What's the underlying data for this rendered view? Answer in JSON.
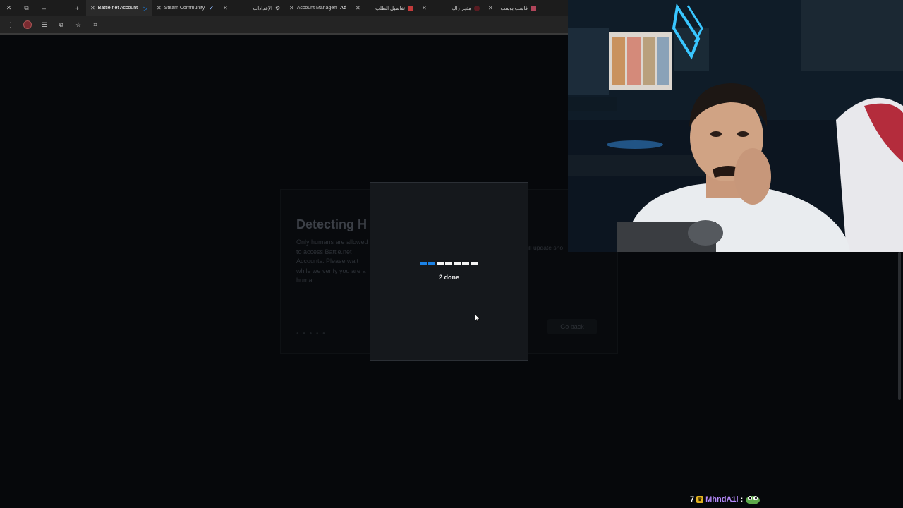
{
  "browser": {
    "tabs": [
      {
        "title": "Battle.net Account",
        "active": true
      },
      {
        "title": "Steam Community",
        "active": false
      },
      {
        "title": "الإعدادات",
        "active": false
      },
      {
        "title": "Account Managem",
        "active": false
      },
      {
        "title": "تفاصيل الطلب",
        "active": false
      },
      {
        "title": "متجر راك",
        "active": false
      },
      {
        "title": "فاست بوست",
        "active": false
      }
    ],
    "new_tab_label": "+",
    "minimize_label": "–",
    "close_label": "✕"
  },
  "page": {
    "heading": "Detecting H",
    "description": "Only humans are allowed to access Battle.net Accounts. Please wait while we verify you are a human.",
    "right_text": "ill update sho",
    "go_back_label": "Go back"
  },
  "modal": {
    "progress_done": 2,
    "progress_total": 7,
    "status_text": "2 done"
  },
  "chat": {
    "count": "7",
    "username": "MhndA1i",
    "separator": ":",
    "colors": {
      "username": "#b88cff",
      "badge": "#e3b321"
    }
  },
  "colors": {
    "progress_done": "#1b82e6",
    "progress_pending": "#f4f4f4",
    "modal_bg": "#15181c",
    "page_bg": "#06080b"
  }
}
